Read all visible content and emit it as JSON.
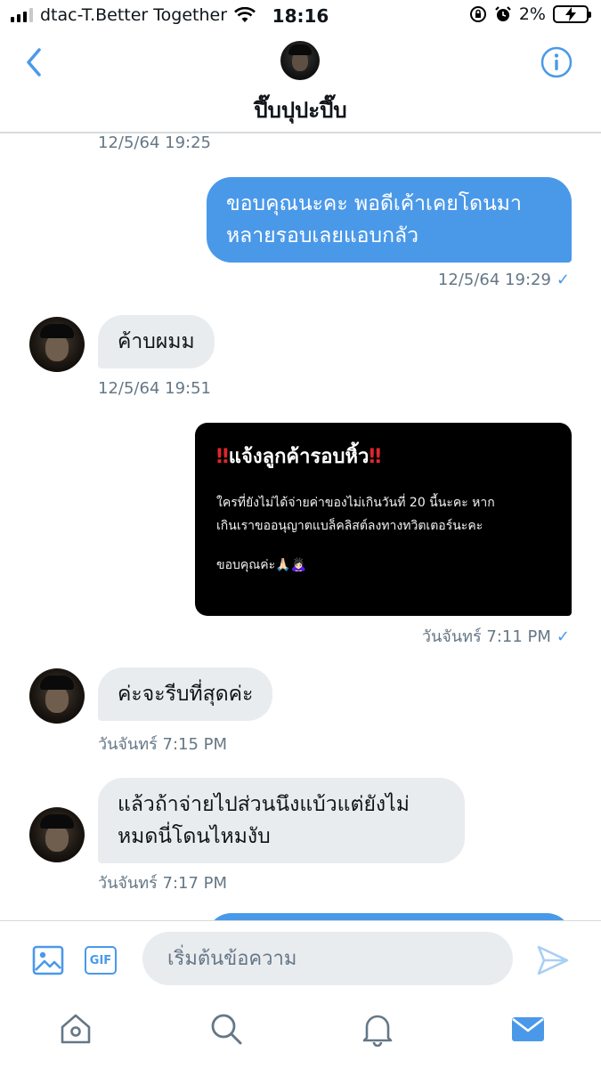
{
  "status_bar": {
    "carrier": "dtac-T.Better Together",
    "time": "18:16",
    "battery": "2%"
  },
  "header": {
    "title": "ปึ๊บปุปะปึ๊บ"
  },
  "messages": {
    "ts0": "12/5/64 19:25",
    "m1_line1": "ขอบคุณนะคะ พอดีเค้าเคยโดนมา",
    "m1_line2": "หลายรอบเลยแอบกลัว",
    "ts1": "12/5/64 19:29",
    "m2": "ค้าบผมม",
    "ts2": "12/5/64 19:51",
    "img_title": "แจ้งลูกค้ารอบหิ้ว",
    "img_body_line1": "ใครที่ยังไม่ได้จ่ายค่าของไม่เกินวันที่ 20 นี้นะคะ หาก",
    "img_body_line2": "เกินเราขออนุญาตแบล็คลิสต์ลงทางทวิตเตอร์นะคะ",
    "img_thanks": "ขอบคุณค่ะ🙏🏻🙇🏻‍♀️",
    "ts3": "วันจันทร์ 7:11 PM",
    "m3": "ค่ะจะรีบที่สุดค่ะ",
    "ts4": "วันจันทร์ 7:15 PM",
    "m4_line1": "แล้วถ้าจ่ายไปส่วนนึงแบ้วแต่ยังไม่",
    "m4_line2": "หมดนี่โดนไหมงับ",
    "ts5": "วันจันทร์ 7:17 PM"
  },
  "composer": {
    "placeholder": "เริ่มต้นข้อความ",
    "gif_label": "GIF"
  },
  "colors": {
    "accent": "#4a99e9",
    "incoming_bubble": "#e9ecef",
    "timestamp": "#657786"
  },
  "icons": {
    "back": "chevron-left-icon",
    "info": "info-icon",
    "image": "image-icon",
    "gif": "gif-icon",
    "send": "send-icon",
    "home": "home-icon",
    "search": "search-icon",
    "notifications": "bell-icon",
    "messages": "mail-icon"
  }
}
